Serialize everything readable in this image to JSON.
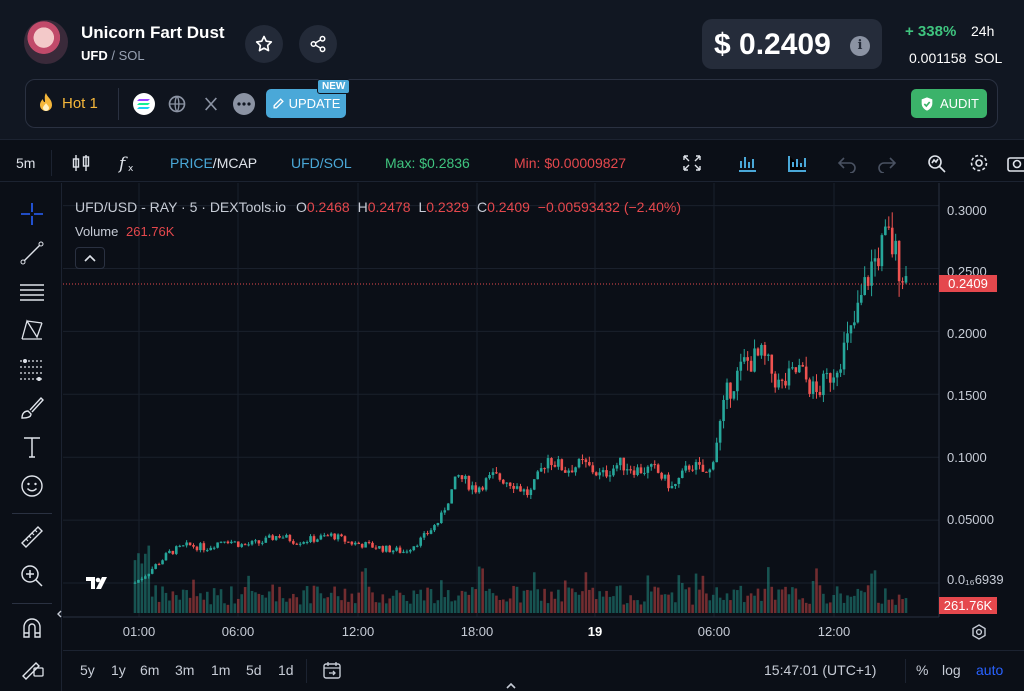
{
  "token": {
    "name": "Unicorn Fart Dust",
    "symbol": "UFD",
    "pair_sep": "/",
    "quote": "SOL"
  },
  "price": {
    "value": "$ 0.2409",
    "change": "+ 338%",
    "period": "24h",
    "sol_value": "0.001158",
    "sol_unit": "SOL"
  },
  "badges": {
    "hot": "Hot 1",
    "update": "UPDATE",
    "new": "NEW",
    "audit": "AUDIT"
  },
  "chart_toolbar": {
    "interval": "5m",
    "price_mcap_a": "PRICE",
    "price_mcap_sep": "/",
    "price_mcap_b": "MCAP",
    "pair": "UFD/SOL",
    "max": "Max: $0.2836",
    "min": "Min: $0.00009827"
  },
  "legend": {
    "title": "UFD/USD - RAY · 5 · DEXTools.io",
    "o_label": "O",
    "o": "0.2468",
    "h_label": "H",
    "h": "0.2478",
    "l_label": "L",
    "l": "0.2329",
    "c_label": "C",
    "c": "0.2409",
    "change": "−0.00593432 (−2.40%)",
    "volume_label": "Volume",
    "volume": "261.76K"
  },
  "y_axis": {
    "ticks": [
      "0.3000",
      "0.2500",
      "0.2000",
      "0.1500",
      "0.1000",
      "0.05000"
    ],
    "bottom_tick": "0.0₁₆6939",
    "current_price": "0.2409",
    "current_volume": "261.76K"
  },
  "x_axis": {
    "ticks": [
      "01:00",
      "06:00",
      "12:00",
      "18:00",
      "19",
      "06:00",
      "12:00"
    ]
  },
  "bottom_bar": {
    "ranges": [
      "5y",
      "1y",
      "6m",
      "3m",
      "1m",
      "5d",
      "1d"
    ],
    "time": "15:47:01 (UTC+1)",
    "percent": "%",
    "log": "log",
    "auto": "auto"
  },
  "colors": {
    "up": "#26a69a",
    "down": "#ef5350",
    "accent": "#2962ff",
    "bg": "#0b0f17"
  },
  "chart_data": {
    "type": "candlestick",
    "title": "UFD/USD - RAY · 5 · DEXTools.io",
    "x": [
      "00:15",
      "00:45",
      "01:00",
      "01:30",
      "02:00",
      "03:00",
      "04:00",
      "05:00",
      "06:00",
      "07:00",
      "08:00",
      "09:00",
      "10:00",
      "11:00",
      "12:00",
      "13:00",
      "14:00",
      "15:00",
      "16:00",
      "17:00",
      "18:00",
      "19:00",
      "20:00",
      "21:00",
      "22:00",
      "23:00",
      "00:00 (19)",
      "01:00",
      "02:00",
      "03:00",
      "04:00",
      "05:00",
      "06:00",
      "07:00",
      "08:00",
      "09:00",
      "10:00",
      "11:00",
      "12:00",
      "13:00",
      "14:00",
      "15:00",
      "15:30",
      "15:45"
    ],
    "values": [
      0.0001,
      0.012,
      0.025,
      0.03,
      0.028,
      0.035,
      0.03,
      0.032,
      0.038,
      0.033,
      0.035,
      0.038,
      0.032,
      0.03,
      0.027,
      0.025,
      0.035,
      0.05,
      0.085,
      0.075,
      0.085,
      0.08,
      0.07,
      0.1,
      0.09,
      0.095,
      0.085,
      0.095,
      0.09,
      0.09,
      0.075,
      0.095,
      0.085,
      0.15,
      0.175,
      0.18,
      0.155,
      0.17,
      0.15,
      0.17,
      0.2,
      0.25,
      0.275,
      0.2409
    ],
    "volume_last": "261.76K",
    "ylim": [
      0,
      0.31
    ],
    "ylabel": "",
    "xlabel": "",
    "grid": true
  }
}
